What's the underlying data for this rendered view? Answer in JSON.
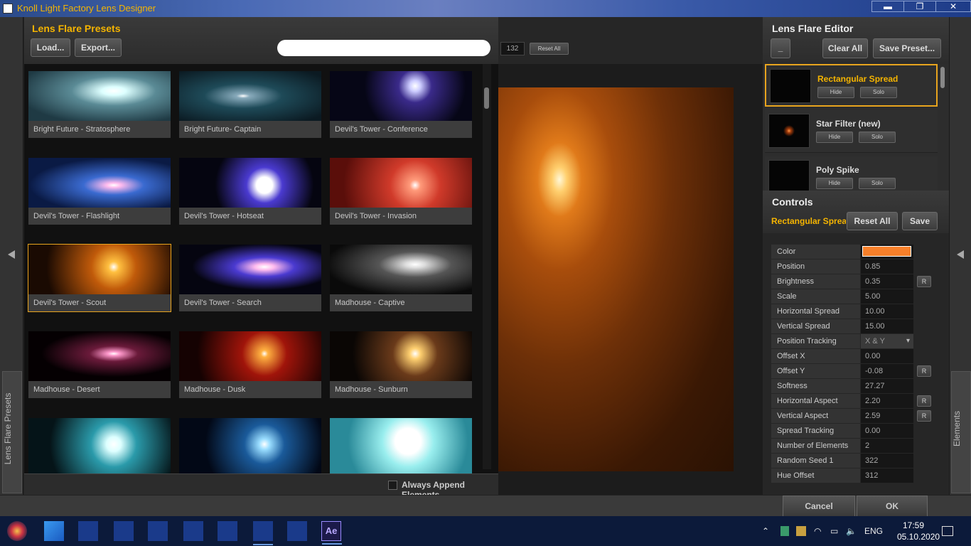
{
  "window": {
    "title": "Knoll Light Factory Lens Designer",
    "minimize": "▬",
    "maximize": "❐",
    "close": "✕"
  },
  "left_tab": {
    "label": "Lens Flare Presets"
  },
  "right_tab": {
    "label": "Elements"
  },
  "presets": {
    "title": "Lens Flare Presets",
    "load_label": "Load...",
    "export_label": "Export...",
    "search_placeholder": "",
    "items": [
      {
        "label": "Bright Future - Stratosphere",
        "bg": "radial-gradient(ellipse at 60% 40%, #fff 0%, #dff 10%, #5a8a95 35%, #1f3a44 80%)"
      },
      {
        "label": "Bright Future- Captain",
        "bg": "radial-gradient(ellipse at 45% 50%, #fff 0%, #8ab 6%, #1e4a58 35%, #0b1a22 90%)"
      },
      {
        "label": "Devil's Tower - Conference",
        "bg": "radial-gradient(circle at 60% 30%, #fff 0%, #ccf 6%, #3a2a8a 18%, #060616 55%)"
      },
      {
        "label": "Devil's Tower - Flashlight",
        "bg": "radial-gradient(ellipse at 60% 55%, #fff 0%, #fbe 6%, #3a6ad0 25%, #0a1a44 70%)"
      },
      {
        "label": "Devil's Tower - Hotseat",
        "bg": "radial-gradient(circle at 60% 55%, #fff 0%, #fff 9%, #4a3ad0 20%, #050510 55%)"
      },
      {
        "label": "Devil's Tower - Invasion",
        "bg": "radial-gradient(circle at 60% 55%, #fff 0%, #ff9a7a 6%, #d03a2a 28%, #5a0e0a 80%)"
      },
      {
        "label": "Devil's Tower - Scout",
        "bg": "radial-gradient(circle at 60% 45%, #fff 0%, #ffc040 6%, #c05a0a 25%, #1a0a02 75%)"
      },
      {
        "label": "Devil's Tower - Search",
        "bg": "radial-gradient(ellipse at 60% 45%, #fff 0%, #fbe 8%, #4a3ad0 25%, #050510 60%)"
      },
      {
        "label": "Madhouse - Captive",
        "bg": "radial-gradient(ellipse at 60% 40%, #fff 0%, #ddd 8%, #555 30%, #0a0a0a 75%)"
      },
      {
        "label": "Madhouse - Desert",
        "bg": "radial-gradient(ellipse at 60% 45%, #fff 0%, #f9c 5%, #6a1a3a 20%, #050002 60%)"
      },
      {
        "label": "Madhouse - Dusk",
        "bg": "radial-gradient(circle at 60% 45%, #fff 0%, #ffb040 4%, #a0140a 25%, #150202 75%)"
      },
      {
        "label": "Madhouse - Sunburn",
        "bg": "radial-gradient(circle at 60% 45%, #fff 0%, #ffd070 6%, #6a3a1a 25%, #0a0604 70%)"
      },
      {
        "label": "",
        "bg": "radial-gradient(circle at 60% 45%, #fff 0%, #dff 8%, #2a9aaa 25%, #051418 70%)"
      },
      {
        "label": "",
        "bg": "radial-gradient(circle at 60% 45%, #fff 0%, #9df 6%, #1a5a9a 22%, #020816 65%)"
      },
      {
        "label": "",
        "bg": "radial-gradient(circle at 55% 40%, #fff 0%, #fff 15%, #9ee 30%, #2a8a99 70%)"
      }
    ],
    "always_append_label": "Always Append Elements"
  },
  "preview": {
    "frame_number": "132",
    "reset_all_label": "Reset All"
  },
  "editor": {
    "title": "Lens Flare Editor",
    "collapse_label": "_",
    "clear_all_label": "Clear All",
    "save_preset_label": "Save Preset...",
    "elements": [
      {
        "name": "Rectangular Spread",
        "hide": "Hide",
        "solo": "Solo",
        "selected": true
      },
      {
        "name": "Star Filter (new)",
        "hide": "Hide",
        "solo": "Solo",
        "selected": false
      },
      {
        "name": "Poly Spike",
        "hide": "Hide",
        "solo": "Solo",
        "selected": false
      }
    ],
    "controls": {
      "title": "Controls",
      "current_element": "Rectangular Spread",
      "reset_all_label": "Reset All",
      "save_label": "Save",
      "r_label": "R",
      "properties": [
        {
          "label": "Color",
          "value": "",
          "color": "#f7802a"
        },
        {
          "label": "Position",
          "value": "0.85"
        },
        {
          "label": "Brightness",
          "value": "0.35",
          "has_r": true
        },
        {
          "label": "Scale",
          "value": "5.00"
        },
        {
          "label": "Horizontal Spread",
          "value": "10.00"
        },
        {
          "label": "Vertical Spread",
          "value": "15.00"
        },
        {
          "label": "Position Tracking",
          "value": "X & Y",
          "dropdown": true
        },
        {
          "label": "Offset X",
          "value": "0.00"
        },
        {
          "label": "Offset Y",
          "value": "-0.08",
          "has_r": true
        },
        {
          "label": "Softness",
          "value": "27.27"
        },
        {
          "label": "Horizontal Aspect",
          "value": "2.20",
          "has_r": true
        },
        {
          "label": "Vertical Aspect",
          "value": "2.59",
          "has_r": true
        },
        {
          "label": "Spread Tracking",
          "value": "0.00"
        },
        {
          "label": "Number of Elements",
          "value": "2"
        },
        {
          "label": "Random Seed 1",
          "value": "322"
        },
        {
          "label": "Hue Offset",
          "value": "312"
        }
      ]
    }
  },
  "footer": {
    "cancel_label": "Cancel",
    "ok_label": "OK"
  },
  "taskbar": {
    "language": "ENG",
    "time": "17:59",
    "date": "05.10.2020"
  },
  "colors": {
    "accent": "#f5b400",
    "selection": "#e8a41e"
  }
}
